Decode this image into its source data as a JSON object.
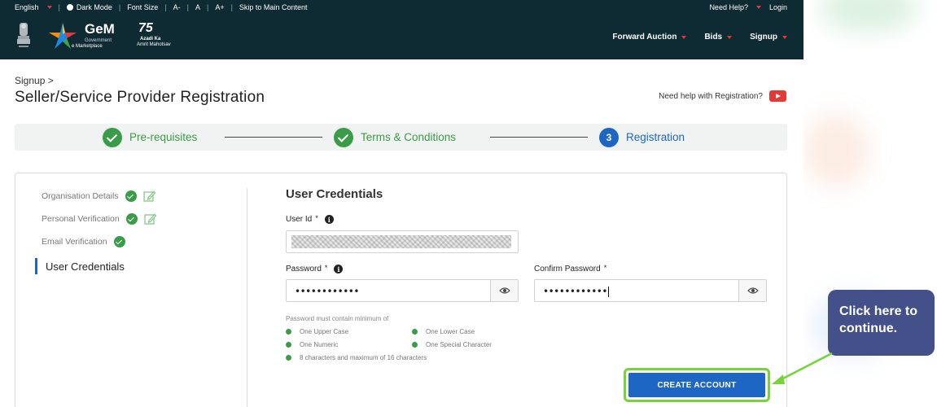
{
  "topbar": {
    "language": "English",
    "dark_mode": "Dark Mode",
    "font_size": "Font Size",
    "font_small": "A-",
    "font_normal": "A",
    "font_large": "A+",
    "skip": "Skip to Main Content",
    "need_help": "Need Help?",
    "login": "Login"
  },
  "header": {
    "logo_word": "GeM",
    "logo_sub1": "Government",
    "logo_sub2": "e Marketplace",
    "azadi_num": "75",
    "azadi_line1": "Azadi Ka",
    "azadi_line2": "Amrit Mahotsav",
    "nav": [
      "Forward Auction",
      "Bids",
      "Signup"
    ]
  },
  "page": {
    "breadcrumb": "Signup >",
    "title": "Seller/Service Provider Registration",
    "help_text": "Need help with Registration?"
  },
  "stepper": {
    "steps": [
      {
        "label": "Pre-requisites",
        "status": "done"
      },
      {
        "label": "Terms & Conditions",
        "status": "done"
      },
      {
        "number": "3",
        "label": "Registration",
        "status": "current"
      }
    ]
  },
  "sidebar": {
    "items": [
      {
        "label": "Organisation Details",
        "done": true,
        "editable": true
      },
      {
        "label": "Personal Verification",
        "done": true,
        "editable": true
      },
      {
        "label": "Email Verification",
        "done": true,
        "editable": false
      }
    ],
    "active": "User Credentials"
  },
  "form": {
    "section_title": "User Credentials",
    "user_id_label": "User Id",
    "required_mark": "*",
    "password_label": "Password",
    "password_value": "••••••••••••",
    "confirm_label": "Confirm Password",
    "confirm_value": "••••••••••••",
    "rules_title": "Password must contain minimum of",
    "rules": [
      "One Upper Case",
      "One Lower Case",
      "One Numeric",
      "One Special Character",
      "8 characters and maximum of 16 characters"
    ],
    "create_button": "CREATE ACCOUNT"
  },
  "callout": {
    "text": "Click here to continue."
  },
  "colors": {
    "header_bg": "#0e2a33",
    "accent_blue": "#1e66c4",
    "success_green": "#3a9b48",
    "highlight_green": "#76d43a",
    "callout_bg": "#445089"
  }
}
